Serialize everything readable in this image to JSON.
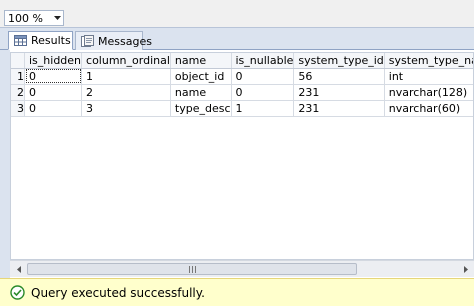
{
  "toolbar": {
    "zoom_value": "100 %"
  },
  "tabs": [
    {
      "label": "Results",
      "icon": "grid-icon",
      "active": true
    },
    {
      "label": "Messages",
      "icon": "messages-icon",
      "active": false
    }
  ],
  "grid": {
    "columns": [
      "is_hidden",
      "column_ordinal",
      "name",
      "is_nullable",
      "system_type_id",
      "system_type_name"
    ],
    "rows": [
      {
        "num": "1",
        "cells": [
          "0",
          "1",
          "object_id",
          "0",
          "56",
          "int"
        ]
      },
      {
        "num": "2",
        "cells": [
          "0",
          "2",
          "name",
          "0",
          "231",
          "nvarchar(128)"
        ]
      },
      {
        "num": "3",
        "cells": [
          "0",
          "3",
          "type_desc",
          "1",
          "231",
          "nvarchar(60)"
        ]
      }
    ]
  },
  "status": {
    "message": "Query executed successfully.",
    "icon": "check-circle-icon",
    "color": "#ffffcc"
  },
  "colors": {
    "tab_strip": "#dbe3ef",
    "status_ok": "#2a8a2a"
  }
}
